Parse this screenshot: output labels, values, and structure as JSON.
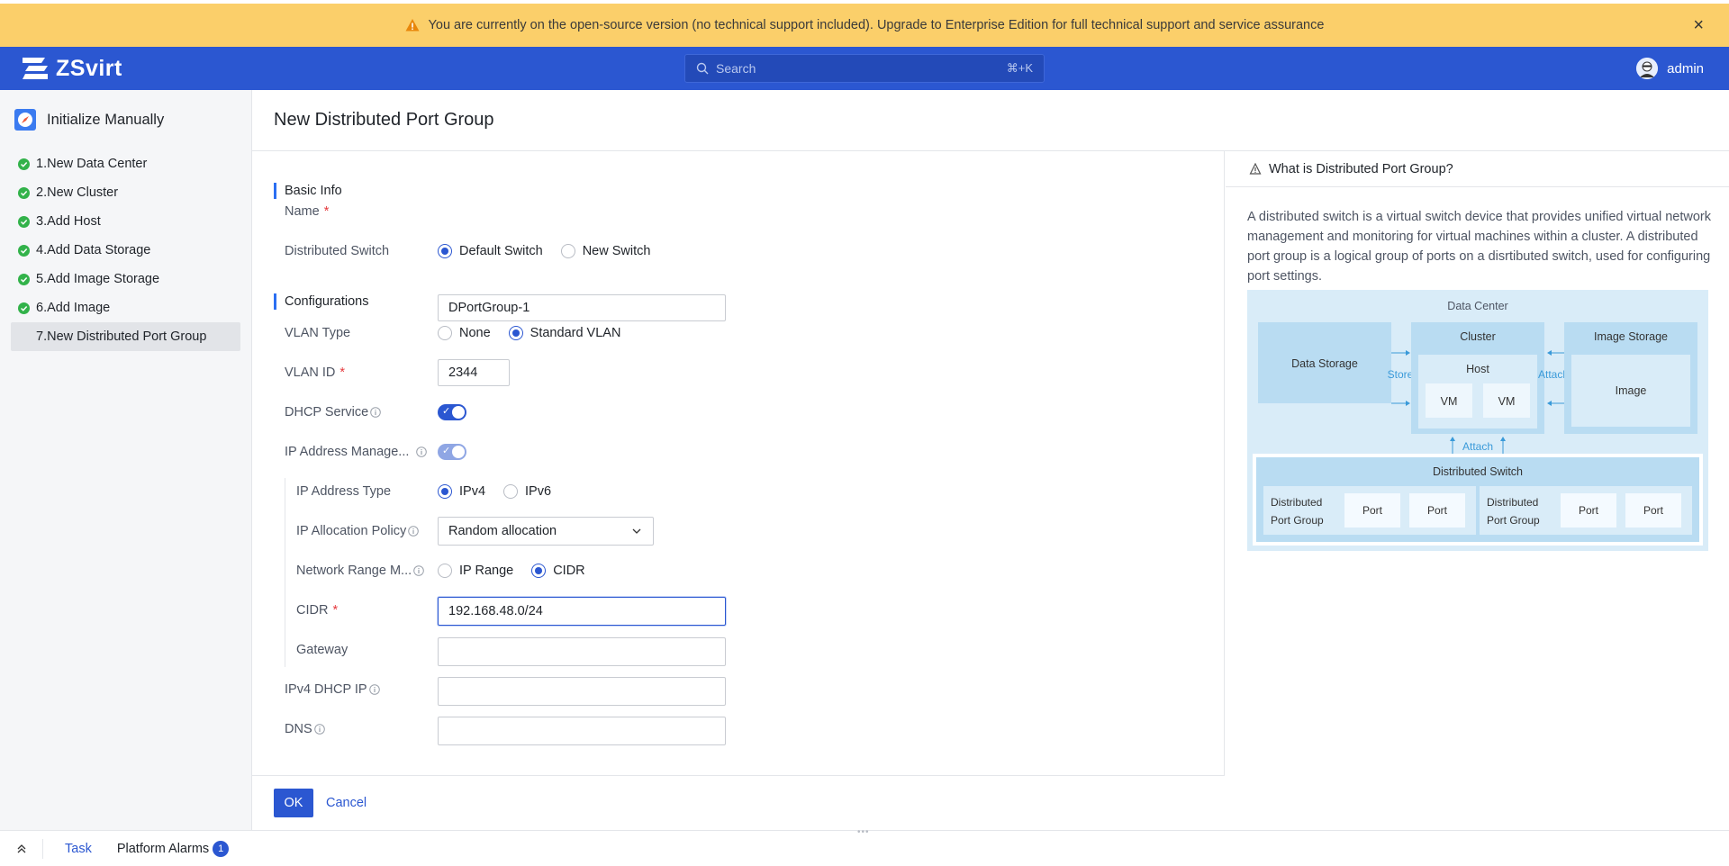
{
  "banner": {
    "message": "You are currently on the open-source version (no technical support included). Upgrade to Enterprise Edition for full technical support and service assurance",
    "close_icon": "close-icon",
    "accent": "#fbcf6a"
  },
  "header": {
    "brand": "ZSvirt",
    "search_placeholder": "Search",
    "search_shortcut": "⌘+K",
    "user_name": "admin",
    "bg_color": "#2b57d1"
  },
  "sidebar": {
    "title": "Initialize Manually",
    "steps": [
      {
        "label": "1.New Data Center",
        "done": true
      },
      {
        "label": "2.New Cluster",
        "done": true
      },
      {
        "label": "3.Add Host",
        "done": true
      },
      {
        "label": "4.Add Data Storage",
        "done": true
      },
      {
        "label": "5.Add Image Storage",
        "done": true
      },
      {
        "label": "6.Add Image",
        "done": true
      },
      {
        "label": "7.New Distributed Port Group",
        "done": false,
        "active": true
      }
    ]
  },
  "page": {
    "title": "New Distributed Port Group"
  },
  "form": {
    "basic_info": "Basic Info",
    "name_label": "Name",
    "name_value": "DPortGroup-1",
    "switch_label": "Distributed Switch",
    "switch_options": [
      "Default Switch",
      "New Switch"
    ],
    "switch_selected": "Default Switch",
    "configurations": "Configurations",
    "vlan_type_label": "VLAN Type",
    "vlan_type_options": [
      "None",
      "Standard VLAN"
    ],
    "vlan_type_selected": "Standard VLAN",
    "vlan_id_label": "VLAN ID",
    "vlan_id_value": "2344",
    "dhcp_label": "DHCP Service",
    "dhcp_on": true,
    "ipam_label": "IP Address Manage...",
    "ipam_on": true,
    "ip_type_label": "IP Address Type",
    "ip_type_options": [
      "IPv4",
      "IPv6"
    ],
    "ip_type_selected": "IPv4",
    "alloc_label": "IP Allocation Policy",
    "alloc_value": "Random allocation",
    "range_label": "Network Range M...",
    "range_options": [
      "IP Range",
      "CIDR"
    ],
    "range_selected": "CIDR",
    "cidr_label": "CIDR",
    "cidr_value": "192.168.48.0/24",
    "gateway_label": "Gateway",
    "gateway_value": "",
    "dhcp_ip_label": "IPv4 DHCP IP",
    "dhcp_ip_value": "",
    "dns_label": "DNS",
    "dns_value": "",
    "ok_label": "OK",
    "cancel_label": "Cancel"
  },
  "help": {
    "title": "What is Distributed Port Group?",
    "body": "A distributed switch is a virtual switch device that provides unified virtual network management and monitoring for virtual machines within a cluster. A distributed port group is a logical group of ports on a disrtibuted switch, used for configuring port settings.",
    "diagram": {
      "data_center": "Data Center",
      "data_storage": "Data Storage",
      "store": "Store",
      "cluster": "Cluster",
      "host": "Host",
      "vm1": "VM",
      "vm2": "VM",
      "attach1": "Attach",
      "image_storage": "Image Storage",
      "image": "Image",
      "attach2": "Attach",
      "distributed_switch": "Distributed Switch",
      "dpg1_line1": "Distributed",
      "dpg1_line2": "Port Group",
      "port1": "Port",
      "port2": "Port",
      "dpg2_line1": "Distributed",
      "dpg2_line2": "Port Group",
      "port3": "Port",
      "port4": "Port"
    }
  },
  "bottombar": {
    "task_label": "Task",
    "alarm_label": "Platform Alarms",
    "alarm_count": "1"
  }
}
